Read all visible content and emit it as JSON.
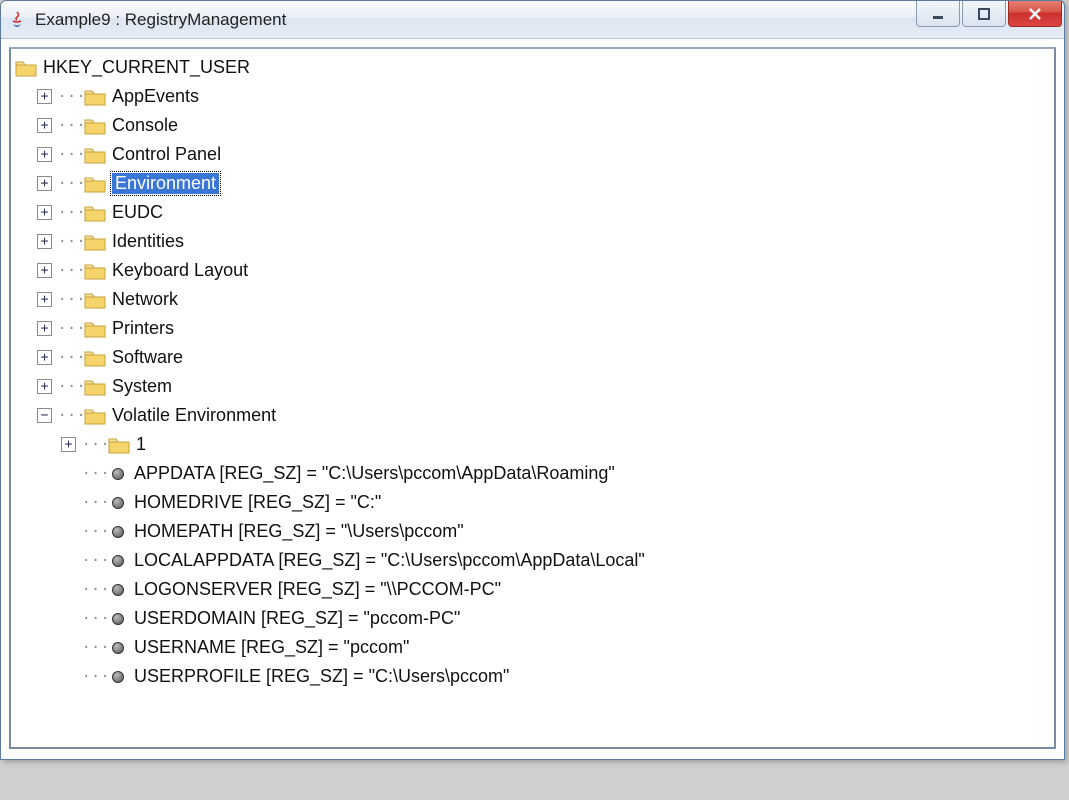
{
  "window": {
    "title": "Example9 : RegistryManagement"
  },
  "root": {
    "label": "HKEY_CURRENT_USER"
  },
  "folders": [
    {
      "label": "AppEvents",
      "selected": false
    },
    {
      "label": "Console",
      "selected": false
    },
    {
      "label": "Control Panel",
      "selected": false
    },
    {
      "label": "Environment",
      "selected": true
    },
    {
      "label": "EUDC",
      "selected": false
    },
    {
      "label": "Identities",
      "selected": false
    },
    {
      "label": "Keyboard Layout",
      "selected": false
    },
    {
      "label": "Network",
      "selected": false
    },
    {
      "label": "Printers",
      "selected": false
    },
    {
      "label": "Software",
      "selected": false
    },
    {
      "label": "System",
      "selected": false
    }
  ],
  "expanded": {
    "label": "Volatile Environment",
    "subfolder": {
      "label": "1"
    },
    "values": [
      "APPDATA  [REG_SZ] = \"C:\\Users\\pccom\\AppData\\Roaming\"",
      "HOMEDRIVE  [REG_SZ] = \"C:\"",
      "HOMEPATH  [REG_SZ] = \"\\Users\\pccom\"",
      "LOCALAPPDATA  [REG_SZ] = \"C:\\Users\\pccom\\AppData\\Local\"",
      "LOGONSERVER  [REG_SZ] = \"\\\\PCCOM-PC\"",
      "USERDOMAIN  [REG_SZ] = \"pccom-PC\"",
      "USERNAME  [REG_SZ] = \"pccom\"",
      "USERPROFILE  [REG_SZ] = \"C:\\Users\\pccom\""
    ]
  }
}
